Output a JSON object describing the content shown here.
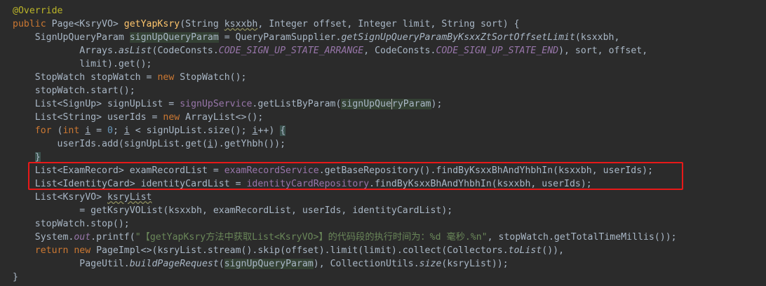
{
  "editor": {
    "theme_colors": {
      "background": "#2b2b2b",
      "default_text": "#a9b7c6",
      "keyword": "#cc7832",
      "method_declaration": "#ffc66d",
      "field": "#9876aa",
      "string": "#6a8759",
      "number": "#6897bb",
      "annotation": "#bbb529",
      "highlight_box": "#e81919"
    },
    "lines": [
      [
        {
          "t": "@Override",
          "c": "anno"
        }
      ],
      [
        {
          "t": "public ",
          "c": "kw"
        },
        {
          "t": "Page<KsryVO> "
        },
        {
          "t": "getYapKsry",
          "c": "fn"
        },
        {
          "t": "(String "
        },
        {
          "t": "ksxxbh",
          "c": "squig"
        },
        {
          "t": ", Integer offset, Integer limit, String sort) {"
        }
      ],
      [
        {
          "t": "    SignUpQueryParam "
        },
        {
          "t": "signUpQueryParam",
          "c": "hl-param"
        },
        {
          "t": " = QueryParamSupplier."
        },
        {
          "t": "getSignUpQueryParamByKsxxZtSortOffsetLimit",
          "c": "itc"
        },
        {
          "t": "(ksxxbh,"
        }
      ],
      [
        {
          "t": "            Arrays."
        },
        {
          "t": "asList",
          "c": "itc"
        },
        {
          "t": "(CodeConsts."
        },
        {
          "t": "CODE_SIGN_UP_STATE_ARRANGE",
          "c": "cst"
        },
        {
          "t": ", CodeConsts."
        },
        {
          "t": "CODE_SIGN_UP_STATE_END",
          "c": "cst"
        },
        {
          "t": "), sort, offset,"
        }
      ],
      [
        {
          "t": "            limit).get();"
        }
      ],
      [
        {
          "t": "    StopWatch stopWatch = "
        },
        {
          "t": "new ",
          "c": "kw"
        },
        {
          "t": "StopWatch();"
        }
      ],
      [
        {
          "t": "    stopWatch.start();"
        }
      ],
      [
        {
          "t": "    List<SignUp> signUpList = "
        },
        {
          "t": "signUpService",
          "c": "fld"
        },
        {
          "t": ".getListByParam("
        },
        {
          "t": "signUpQue",
          "c": "hl-param"
        },
        {
          "t": "",
          "c": "caret"
        },
        {
          "t": "ryParam",
          "c": "hl-param"
        },
        {
          "t": ");"
        }
      ],
      [
        {
          "t": "    List<String> userIds = "
        },
        {
          "t": "new ",
          "c": "kw"
        },
        {
          "t": "ArrayList<>();"
        }
      ],
      [
        {
          "t": "    "
        },
        {
          "t": "for ",
          "c": "kw"
        },
        {
          "t": "("
        },
        {
          "t": "int ",
          "c": "kw"
        },
        {
          "t": "i",
          "c": "ul"
        },
        {
          "t": " = "
        },
        {
          "t": "0",
          "c": "num"
        },
        {
          "t": "; "
        },
        {
          "t": "i",
          "c": "ul"
        },
        {
          "t": " < signUpList.size(); "
        },
        {
          "t": "i",
          "c": "ul"
        },
        {
          "t": "++) "
        },
        {
          "t": "{",
          "c": "hl-brace"
        }
      ],
      [
        {
          "t": "        userIds.add(signUpList.get("
        },
        {
          "t": "i",
          "c": "ul"
        },
        {
          "t": ").getYhbh());"
        }
      ],
      [
        {
          "t": "    "
        },
        {
          "t": "}",
          "c": "hl-brace"
        }
      ],
      [
        {
          "t": "    List<ExamRecord> examRecordList = "
        },
        {
          "t": "examRecordService",
          "c": "fld"
        },
        {
          "t": ".getBaseRepository().findByKsxxBhAndYhbhIn(ksxxbh, userIds);"
        }
      ],
      [
        {
          "t": "    List<IdentityCard> identityCardList = "
        },
        {
          "t": "identityCardRepository",
          "c": "fld"
        },
        {
          "t": ".findByKsxxBhAndYhbhIn(ksxxbh, userIds);"
        }
      ],
      [
        {
          "t": "    List<KsryVO> "
        },
        {
          "t": "ksryList",
          "c": "squig"
        }
      ],
      [
        {
          "t": "            = getKsryVOList(ksxxbh, examRecordList, userIds, identityCardList);"
        }
      ],
      [
        {
          "t": "    stopWatch.stop();"
        }
      ],
      [
        {
          "t": "    System."
        },
        {
          "t": "out",
          "c": "cst"
        },
        {
          "t": ".printf("
        },
        {
          "t": "\"【getYapKsry方法中获取List<KsryVO>】的代码段的执行时间为：%d 毫秒.%n\"",
          "c": "str"
        },
        {
          "t": ", stopWatch.getTotalTimeMillis());"
        }
      ],
      [
        {
          "t": "    "
        },
        {
          "t": "return new ",
          "c": "kw"
        },
        {
          "t": "PageImpl<>(ksryList.stream().skip(offset).limit(limit).collect(Collectors."
        },
        {
          "t": "toList",
          "c": "itc"
        },
        {
          "t": "()),"
        }
      ],
      [
        {
          "t": "            PageUtil."
        },
        {
          "t": "buildPageRequest",
          "c": "itc"
        },
        {
          "t": "("
        },
        {
          "t": "signUpQueryParam",
          "c": "hl-param"
        },
        {
          "t": "), CollectionUtils."
        },
        {
          "t": "size",
          "c": "itc"
        },
        {
          "t": "(ksryList));"
        }
      ],
      [
        {
          "t": "}"
        }
      ]
    ]
  }
}
